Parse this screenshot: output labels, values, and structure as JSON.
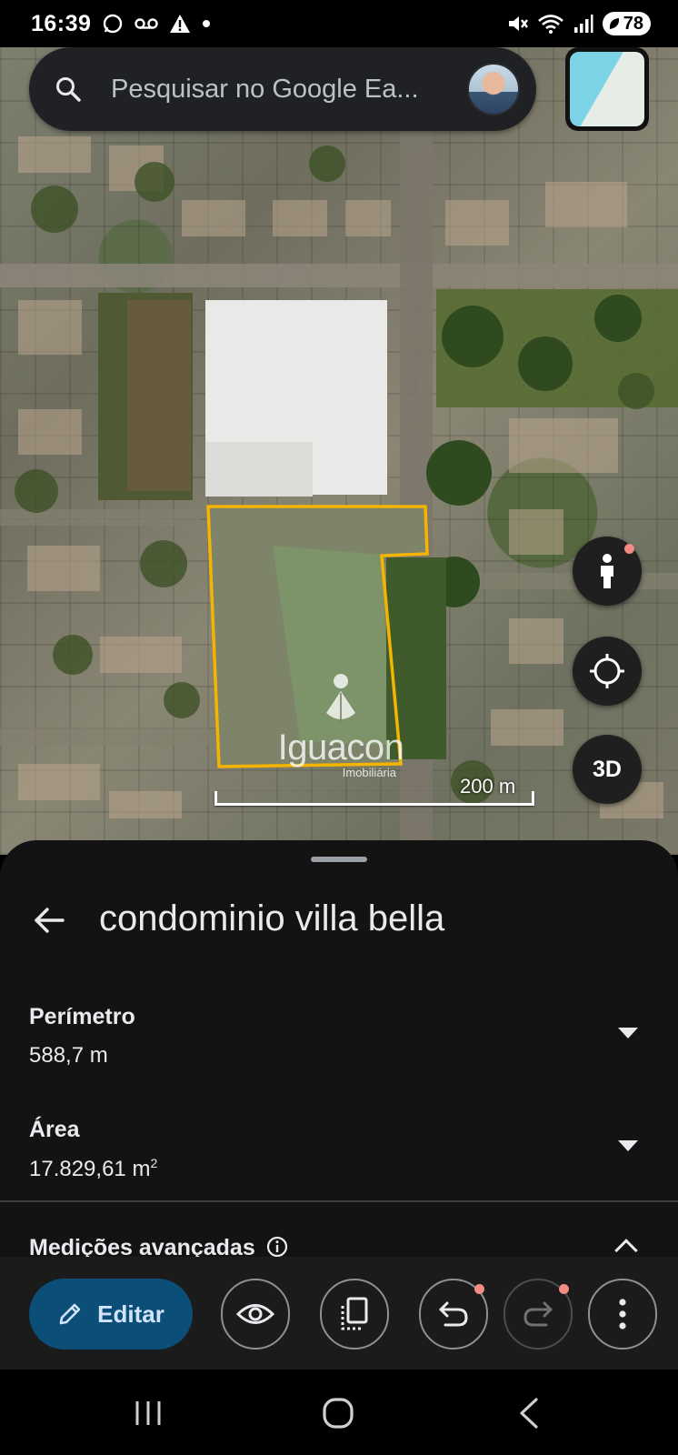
{
  "status_bar": {
    "time": "16:39",
    "battery": "78"
  },
  "search": {
    "placeholder": "Pesquisar no Google Ea..."
  },
  "map": {
    "watermark_name": "Iguacon",
    "watermark_sub": "Imobiliária",
    "scale_label": "200 m",
    "three_d_label": "3D",
    "parcel_outline_color": "#f4b400",
    "icons": [
      "search-icon",
      "pegman-icon",
      "my-location-icon",
      "three-d-button"
    ]
  },
  "sheet": {
    "title": "condominio villa bella",
    "perimeter_label": "Perímetro",
    "perimeter_value": "588,7 m",
    "area_label": "Área",
    "area_value": "17.829,61 m",
    "area_unit_sup": "2",
    "advanced_label": "Medições avançadas"
  },
  "toolbar": {
    "edit_label": "Editar",
    "edit_color": "#0b4f79",
    "icons": [
      "pencil-icon",
      "eye-icon",
      "copy-icon",
      "undo-icon",
      "redo-icon",
      "more-vert-icon"
    ]
  },
  "nav": {
    "icons": [
      "recents-icon",
      "home-icon",
      "back-icon"
    ]
  }
}
